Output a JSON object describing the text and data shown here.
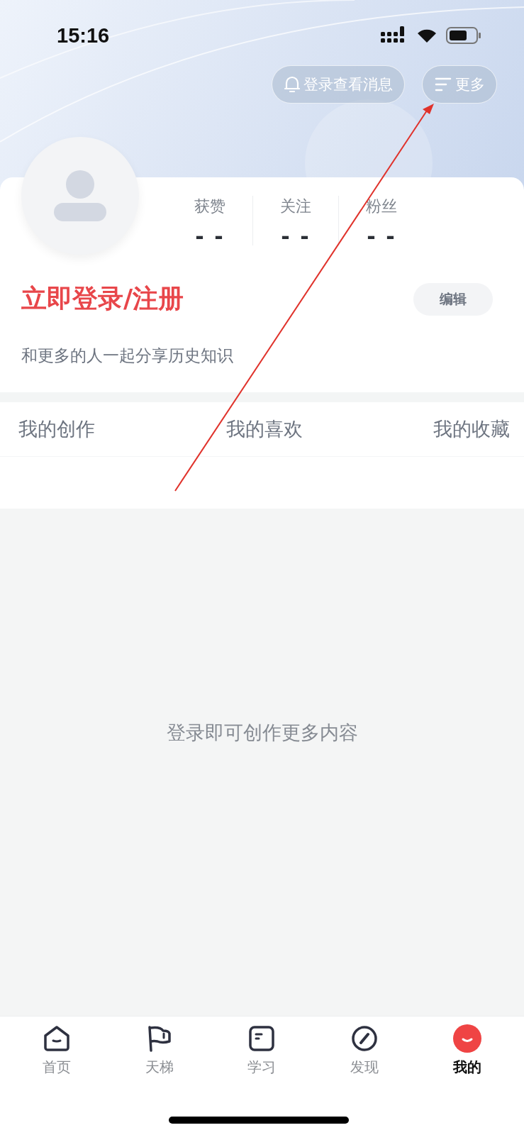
{
  "status_bar": {
    "time": "15:16"
  },
  "header": {
    "buttons": [
      {
        "kind": "bell",
        "label": "登录查看消息"
      },
      {
        "kind": "menu",
        "label": "更多"
      }
    ]
  },
  "profile": {
    "stats": [
      {
        "label": "获赞",
        "value": "- -"
      },
      {
        "label": "关注",
        "value": "- -"
      },
      {
        "label": "粉丝",
        "value": "- -"
      }
    ],
    "login_title": "立即登录/注册",
    "edit_button": "编辑",
    "subtitle": "和更多的人一起分享历史知识"
  },
  "tabs": [
    {
      "label": "我的创作"
    },
    {
      "label": "我的喜欢"
    },
    {
      "label": "我的收藏"
    }
  ],
  "empty_message": "登录即可创作更多内容",
  "bottom_nav": [
    {
      "kind": "home",
      "label": "首页",
      "selected": false
    },
    {
      "kind": "flag",
      "label": "天梯",
      "selected": false
    },
    {
      "kind": "book",
      "label": "学习",
      "selected": false
    },
    {
      "kind": "compass",
      "label": "发现",
      "selected": false
    },
    {
      "kind": "face",
      "label": "我的",
      "selected": true
    }
  ],
  "annotation": {
    "kind": "arrow"
  }
}
